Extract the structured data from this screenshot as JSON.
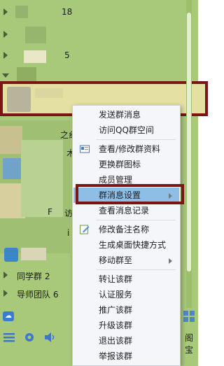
{
  "groups": {
    "item1_count": "18",
    "item2_count": "5",
    "classmates": {
      "label": "同学群",
      "count": "2"
    },
    "mentors": {
      "label": "导师团队",
      "count": "6"
    }
  },
  "partial_text": {
    "t1": "之纟",
    "t2": "木",
    "t3": "F",
    "t4": "访",
    "t5": "i",
    "t6": "阁宝"
  },
  "context_menu": {
    "send_message": "发送群消息",
    "visit_space": "访问QQ群空间",
    "view_edit_info": "查看/修改群资料",
    "change_icon": "更换群图标",
    "member_mgmt": "成员管理",
    "msg_settings": "群消息设置",
    "view_history": "查看消息记录",
    "edit_remark": "修改备注名称",
    "desktop_shortcut": "生成桌面快捷方式",
    "move_to": "移动群至",
    "transfer": "转让该群",
    "certify": "认证服务",
    "promote": "推广该群",
    "upgrade": "升级该群",
    "quit": "退出该群",
    "report": "举报该群"
  },
  "colors": {
    "panel": "#a9c97a",
    "highlight_border": "#7b1414",
    "menu_hover": "#8ebde6",
    "menu_bg": "#f4f6fa"
  },
  "icons": [
    "search-icon",
    "menu-icon",
    "gear-icon",
    "speaker-icon",
    "qzone-icon",
    "grid-icon",
    "card-icon",
    "edit-icon"
  ]
}
